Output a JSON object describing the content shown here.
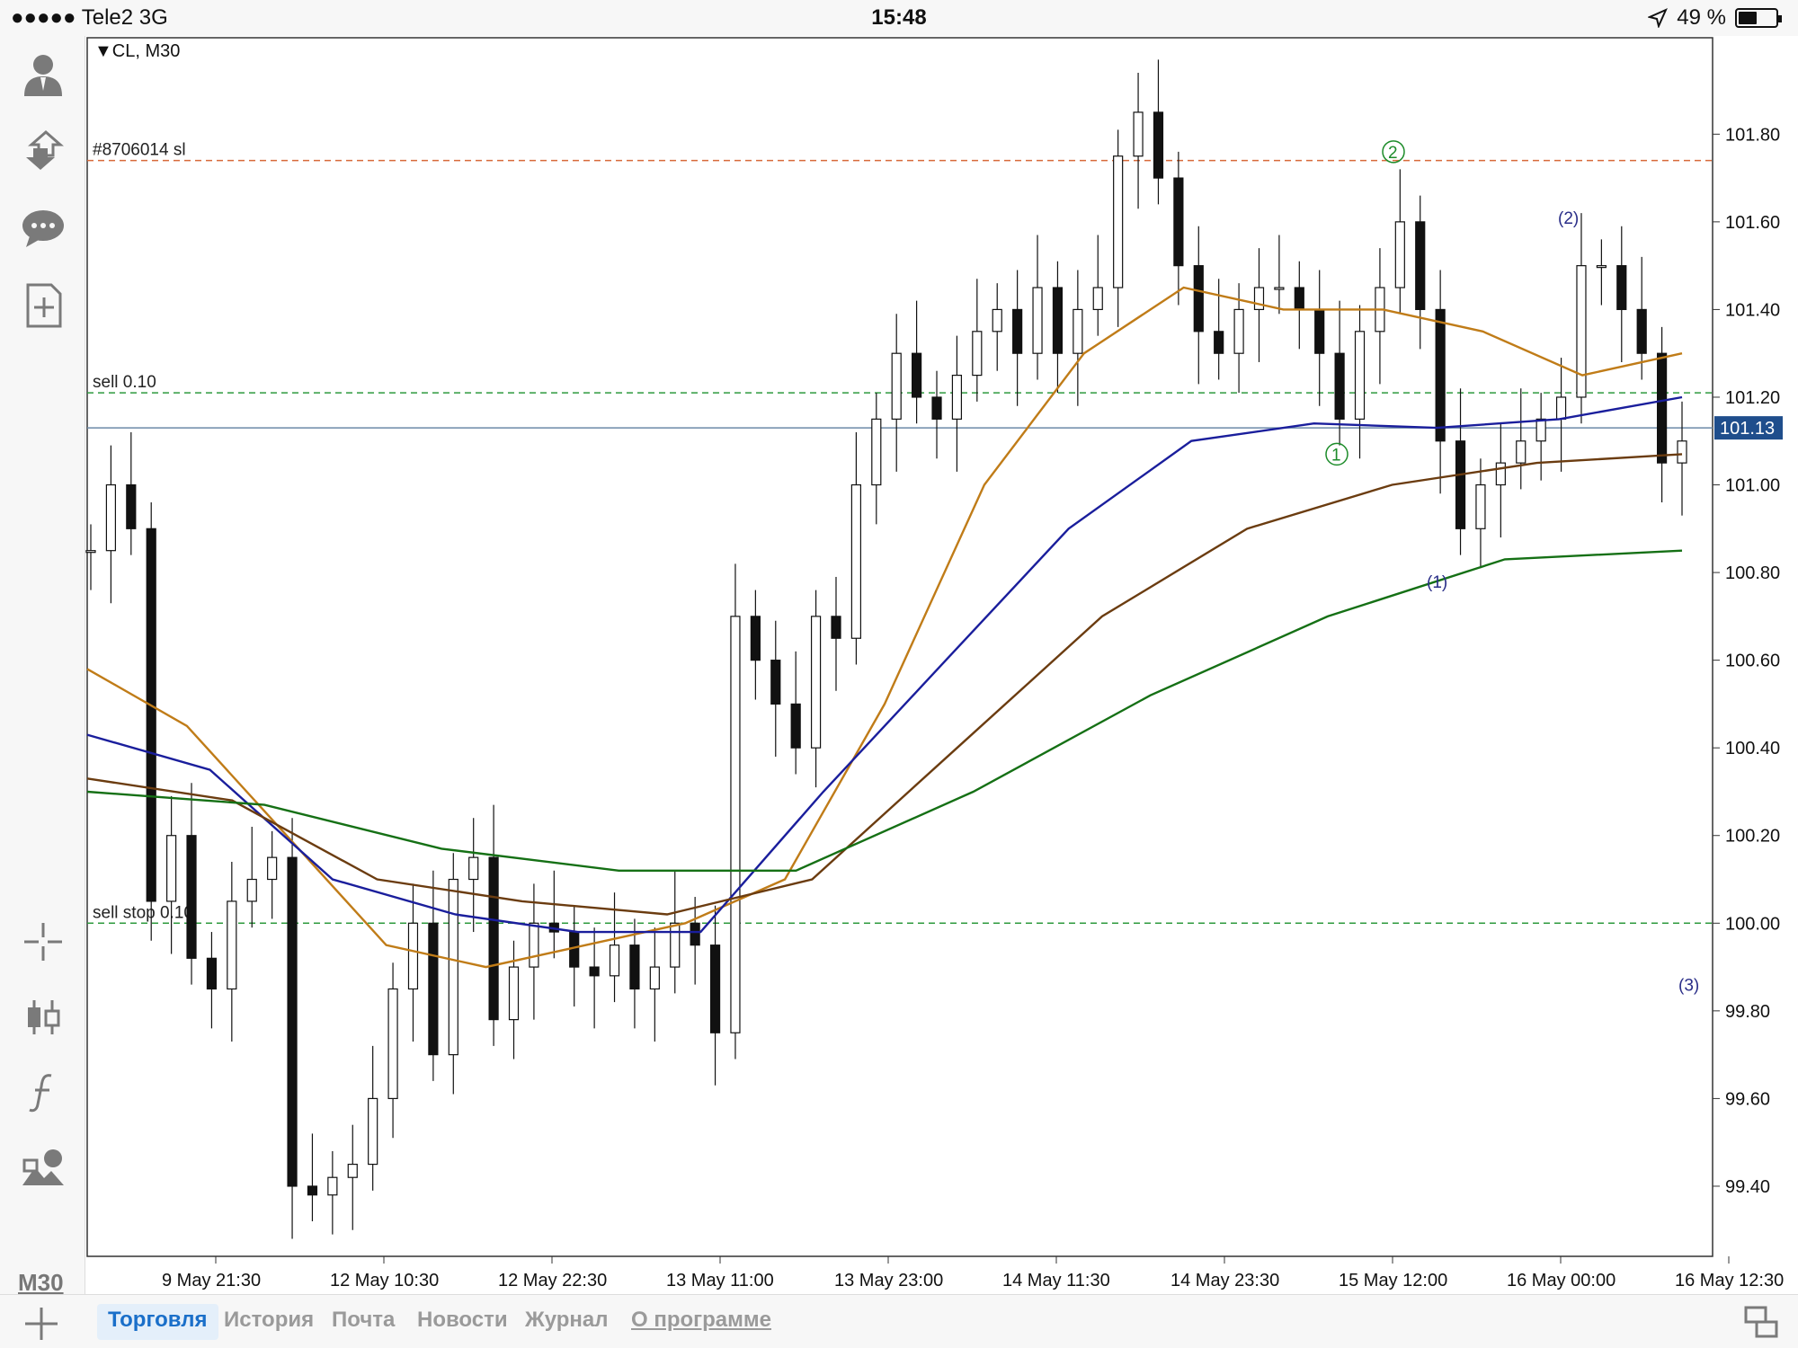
{
  "statusbar": {
    "carrier": "●●●●● Tele2   3G",
    "time": "15:48",
    "battery_text": "49 %",
    "battery_level": 0.49
  },
  "toolbar": {
    "timeframe": "M30",
    "icons": [
      "account-icon",
      "trade-arrows-icon",
      "chat-icon",
      "add-document-icon",
      "crosshair-icon",
      "candlestick-icon",
      "function-icon",
      "objects-icon"
    ]
  },
  "chart": {
    "title": "▼CL, M30",
    "current_price": "101.13",
    "price_badge_color": "#1f4e8c",
    "lines": [
      {
        "label": "#8706014 sl",
        "price": 101.74,
        "color": "#d86a3a"
      },
      {
        "label": "sell 0.10",
        "price": 101.21,
        "color": "#2e9a3e"
      },
      {
        "label": "sell stop 0.10",
        "price": 100.0,
        "color": "#2e9a3e"
      }
    ],
    "markers": [
      {
        "text": "2",
        "color": "#1d8c2a"
      },
      {
        "text": "1",
        "color": "#1d8c2a"
      },
      {
        "text": "(2)",
        "color": "#2a2e88"
      },
      {
        "text": "(1)",
        "color": "#2a2e88"
      },
      {
        "text": "(3)",
        "color": "#2a2e88"
      }
    ]
  },
  "chart_data": {
    "type": "line",
    "symbol": "CL",
    "timeframe": "M30",
    "ylim": [
      99.24,
      102.02
    ],
    "y_ticks": [
      "101.80",
      "101.60",
      "101.40",
      "101.20",
      "101.00",
      "100.80",
      "100.60",
      "100.40",
      "100.20",
      "100.00",
      "99.80",
      "99.60",
      "99.40"
    ],
    "x_labels": [
      "9 May 21:30",
      "12 May 10:30",
      "12 May 22:30",
      "13 May 11:00",
      "13 May 23:00",
      "14 May 11:30",
      "14 May 23:30",
      "15 May 12:00",
      "16 May 00:00",
      "16 May 12:30"
    ],
    "price_series": {
      "name": "",
      "values": [
        100.85,
        101.0,
        100.9,
        100.05,
        100.2,
        99.92,
        99.85,
        100.05,
        100.1,
        100.15,
        99.4,
        99.38,
        99.42,
        99.45,
        99.6,
        99.85,
        100.0,
        99.7,
        100.1,
        100.15,
        99.78,
        99.9,
        100.0,
        99.98,
        99.9,
        99.88,
        99.95,
        99.85,
        99.9,
        100.0,
        99.95,
        99.75,
        100.7,
        100.6,
        100.5,
        100.4,
        100.7,
        100.65,
        101.0,
        101.15,
        101.3,
        101.2,
        101.15,
        101.25,
        101.35,
        101.4,
        101.3,
        101.45,
        101.3,
        101.4,
        101.45,
        101.75,
        101.85,
        101.7,
        101.5,
        101.35,
        101.3,
        101.4,
        101.45,
        101.45,
        101.4,
        101.3,
        101.15,
        101.35,
        101.45,
        101.6,
        101.4,
        101.1,
        100.9,
        101.0,
        101.05,
        101.1,
        101.15,
        101.2,
        101.5,
        101.5,
        101.4,
        101.3,
        101.05,
        101.1
      ]
    },
    "moving_averages": [
      {
        "name": "",
        "color": "#c07c18",
        "values": [
          100.58,
          100.45,
          100.2,
          99.95,
          99.9,
          99.95,
          100.0,
          100.1,
          100.5,
          101.0,
          101.3,
          101.45,
          101.4,
          101.4,
          101.35,
          101.25,
          101.3
        ]
      },
      {
        "name": "",
        "color": "#1a1e9c",
        "values": [
          100.43,
          100.35,
          100.1,
          100.02,
          99.98,
          99.98,
          100.3,
          100.6,
          100.9,
          101.1,
          101.14,
          101.13,
          101.15,
          101.2
        ]
      },
      {
        "name": "",
        "color": "#6b3c10",
        "values": [
          100.33,
          100.28,
          100.1,
          100.05,
          100.02,
          100.1,
          100.4,
          100.7,
          100.9,
          101.0,
          101.05,
          101.07
        ]
      },
      {
        "name": "",
        "color": "#157015",
        "values": [
          100.3,
          100.27,
          100.17,
          100.12,
          100.12,
          100.3,
          100.52,
          100.7,
          100.83,
          100.85
        ]
      }
    ]
  },
  "tabs": [
    {
      "label": "Торговля",
      "active": true
    },
    {
      "label": "История",
      "active": false
    },
    {
      "label": "Почта",
      "active": false
    },
    {
      "label": "Новости",
      "active": false
    },
    {
      "label": "Журнал",
      "active": false
    },
    {
      "label": "О программе",
      "active": false
    }
  ]
}
